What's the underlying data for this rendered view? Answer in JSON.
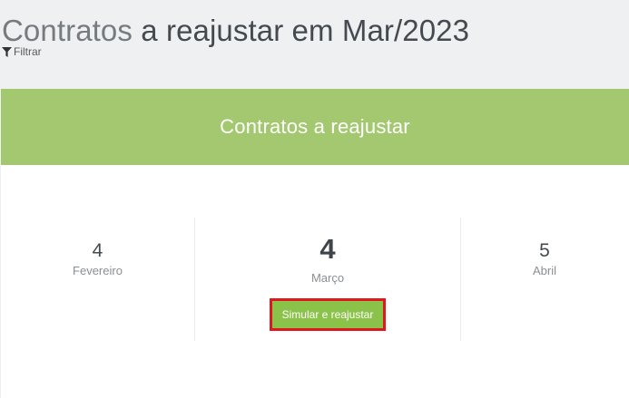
{
  "header": {
    "title_link": "Contratos",
    "title_rest": "a reajustar em Mar/2023",
    "filter_label": "Filtrar"
  },
  "panel": {
    "title": "Contratos a reajustar"
  },
  "months": {
    "previous": {
      "count": "4",
      "name": "Fevereiro"
    },
    "current": {
      "count": "4",
      "name": "Março",
      "action_label": "Simular e reajustar"
    },
    "next": {
      "count": "5",
      "name": "Abril"
    }
  },
  "colors": {
    "panel_header": "#a3c86f",
    "action_button": "#8bc34a",
    "highlight_border": "#e0181d"
  },
  "icons": {
    "filter": "filter-icon"
  }
}
